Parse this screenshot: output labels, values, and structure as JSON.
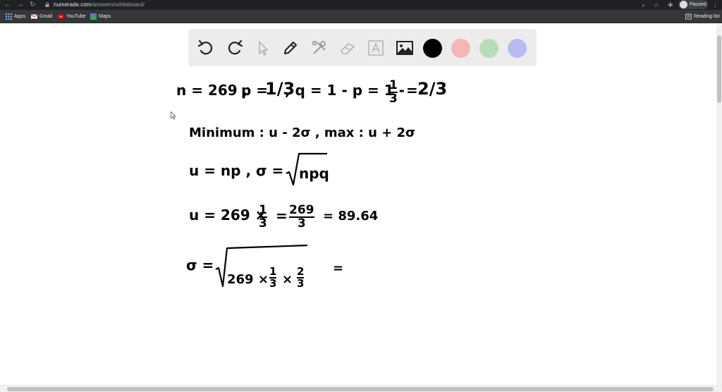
{
  "browser": {
    "url_domain": "numerade.com",
    "url_path": "/answers/whiteboard/",
    "profile_status": "Paused",
    "bookmarks": [
      {
        "label": "Apps",
        "icon": "apps-grid-icon"
      },
      {
        "label": "Gmail",
        "icon": "gmail-icon"
      },
      {
        "label": "YouTube",
        "icon": "youtube-icon"
      },
      {
        "label": "Maps",
        "icon": "maps-icon"
      }
    ],
    "reading_list_label": "Reading list"
  },
  "toolbar": {
    "tools": [
      "undo-icon",
      "redo-icon",
      "select-pointer-icon",
      "pen-icon",
      "tools-icon",
      "eraser-icon",
      "text-icon",
      "image-icon"
    ],
    "colors": [
      "#000000",
      "#f4b6b6",
      "#b8dcb8",
      "#b8bbf0"
    ]
  },
  "whiteboard": {
    "line1": {
      "n_part": "n = 269 ,",
      "p_part": "p =",
      "p_frac": "1/3",
      "q_part": ",  q = 1 - p = 1 -",
      "q_frac_num": "1",
      "q_frac_den": "3",
      "q_eq": "=",
      "q_result": "2/3"
    },
    "line2": "Minimum :  u - 2σ ,   max :  u + 2σ",
    "line3": {
      "mu": "u = np ,  σ =",
      "sqrt": "npq"
    },
    "line4": {
      "lhs": "u = 269 ×",
      "f1_num": "1",
      "f1_den": "3",
      "eq1": "=",
      "f2_num": "269",
      "f2_den": "3",
      "result": "= 89.64"
    },
    "line5": {
      "lhs": "σ =",
      "rad_a": "269 ×",
      "f1_num": "1",
      "f1_den": "3",
      "times": "×",
      "f2_num": "2",
      "f2_den": "3",
      "eq": "="
    }
  }
}
